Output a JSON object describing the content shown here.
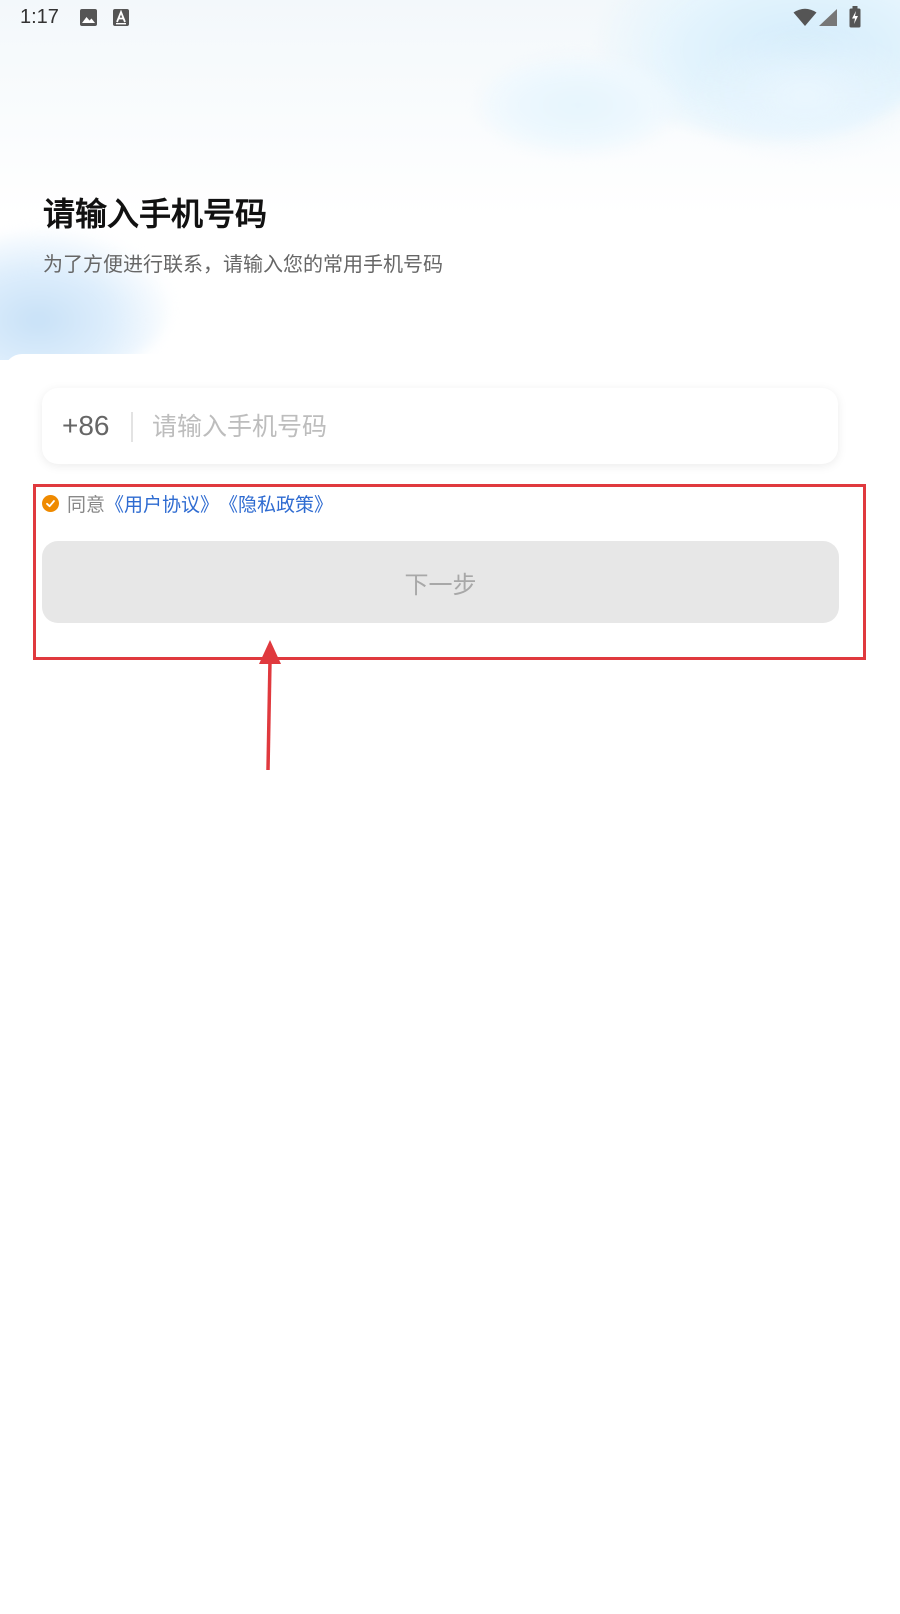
{
  "status_bar": {
    "time": "1:17",
    "left_icons": [
      "image-icon",
      "font-app-icon"
    ],
    "right_icons": [
      "wifi-icon",
      "cellular-signal-icon",
      "battery-charging-icon"
    ]
  },
  "header": {
    "title": "请输入手机号码",
    "subtitle": "为了方便进行联系，请输入您的常用手机号码"
  },
  "phone": {
    "country_code": "+86",
    "placeholder": "请输入手机号码",
    "value": ""
  },
  "agreement": {
    "checked": true,
    "prefix": "同意",
    "user_agreement": "《用户协议》",
    "privacy_policy": "《隐私政策》"
  },
  "next_button": {
    "label": "下一步",
    "enabled": false
  },
  "colors": {
    "accent_orange": "#ef8a00",
    "link_blue": "#2e6bd1",
    "annotation_red": "#e0393e",
    "button_disabled_bg": "#e7e7e7"
  }
}
